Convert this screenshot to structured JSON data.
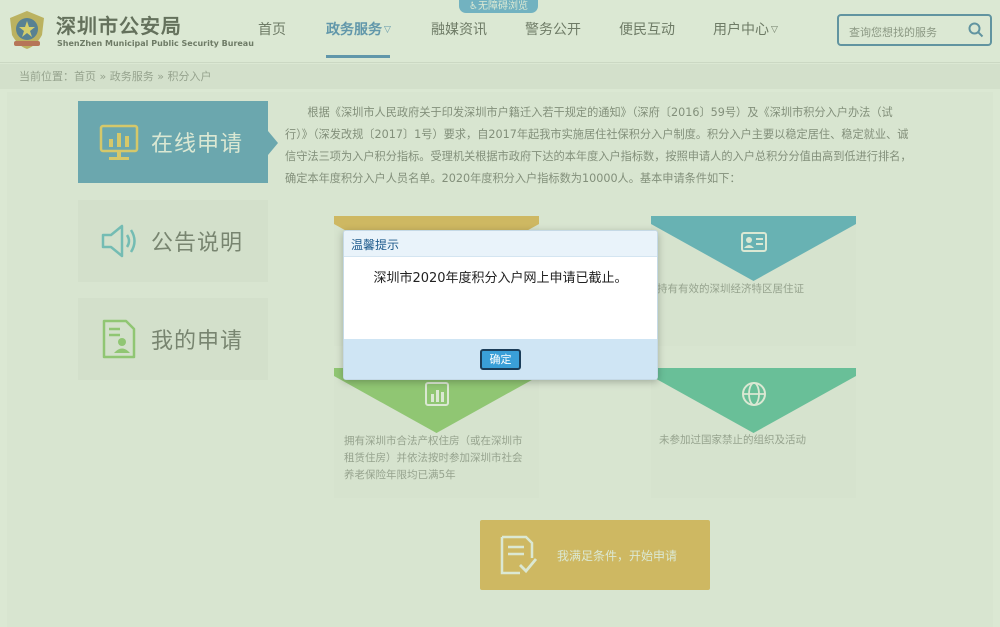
{
  "header": {
    "logo_cn": "深圳市公安局",
    "logo_en": "ShenZhen Municipal Public Security Bureau",
    "accessibility": "♿无障碍浏览",
    "nav": [
      {
        "label": "首页"
      },
      {
        "label": "政务服务",
        "active": true,
        "dropdown": true
      },
      {
        "label": "融媒资讯"
      },
      {
        "label": "警务公开"
      },
      {
        "label": "便民互动"
      },
      {
        "label": "用户中心",
        "dropdown": true
      }
    ],
    "search_placeholder": "查询您想找的服务"
  },
  "breadcrumb": "当前位置：首页 » 政务服务 » 积分入户",
  "sidebar": [
    {
      "label": "在线申请",
      "icon": "chart-monitor-icon",
      "active": true
    },
    {
      "label": "公告说明",
      "icon": "speaker-icon"
    },
    {
      "label": "我的申请",
      "icon": "document-person-icon"
    }
  ],
  "intro": "根据《深圳市人民政府关于印发深圳市户籍迁入若干规定的通知》（深府〔2016〕59号）及《深圳市积分入户办法（试行）》（深发改规〔2017〕1号）要求，自2017年起我市实施居住社保积分入户制度。积分入户主要以稳定居住、稳定就业、诚信守法三项为入户积分指标。受理机关根据市政府下达的本年度入户指标数，按照申请人的入户总积分分值由高到低进行排名，确定本年度积分入户人员名单。2020年度积分入户指标数为10000人。基本申请条件如下：",
  "cards": [
    {
      "text": "",
      "color": "#e9ad3d",
      "icon": "person-icon"
    },
    {
      "text": "持有有效的深圳经济特区居住证",
      "color": "#3aa3c9",
      "icon": "id-card-icon"
    },
    {
      "text": "拥有深圳市合法产权住房（或在深圳市租赁住房）并依法按时参加深圳市社会养老保险年限均已满5年",
      "color": "#7ec45b",
      "icon": "building-icon"
    },
    {
      "text": "未参加过国家禁止的组织及活动",
      "color": "#3cb89a",
      "icon": "globe-icon"
    }
  ],
  "start_button": "我满足条件，开始申请",
  "modal": {
    "title": "温馨提示",
    "message": "深圳市2020年度积分入户网上申请已截止。",
    "ok": "确定"
  },
  "colors": {
    "primary": "#2d74b8",
    "sidebar_active": "#3e8fc0",
    "start_button": "#e9ad3d",
    "overlay": "#aac896"
  }
}
